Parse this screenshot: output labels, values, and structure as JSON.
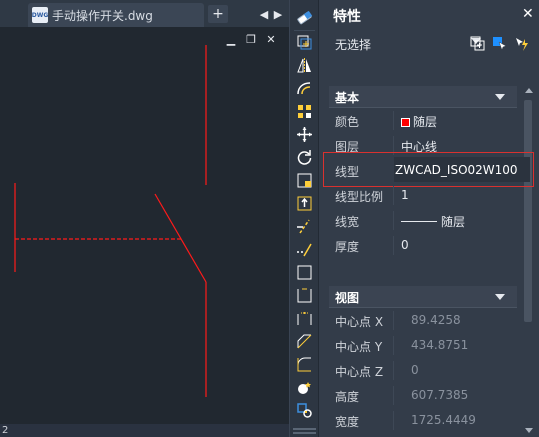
{
  "tab": {
    "doc_name": "手动操作开关.dwg",
    "file_badge": "DWG",
    "new_tab": "+"
  },
  "tab_nav": {
    "prev": "◀",
    "next": "▶"
  },
  "window_controls": {
    "minimize": "▁",
    "restore": "❐",
    "close": "✕"
  },
  "coord_readout": "2",
  "drawing": {
    "line_color": "#ff1a1a"
  },
  "toolbar": {
    "icons": [
      "eraser-icon",
      "copy-icon",
      "mirror-icon",
      "offset-icon",
      "array-icon",
      "move-icon",
      "rotate-icon",
      "scale-icon",
      "stretch-icon",
      "trim-icon",
      "extend-icon",
      "break-icon",
      "break-at-point-icon",
      "join-icon",
      "chamfer-icon",
      "fillet-icon",
      "explode-icon",
      "properties-icon"
    ]
  },
  "panel": {
    "title": "特性",
    "close": "✕",
    "selection": "无选择",
    "sections": [
      {
        "name": "基本",
        "rows": [
          {
            "key": "颜色",
            "value": "随层",
            "swatch": "#ff0000"
          },
          {
            "key": "图层",
            "value": "中心线"
          },
          {
            "key": "线型",
            "value": "ZWCAD_ISO02W100",
            "highlight": true
          },
          {
            "key": "线型比例",
            "value": "1"
          },
          {
            "key": "线宽",
            "value": "随层"
          },
          {
            "key": "厚度",
            "value": "0"
          }
        ]
      },
      {
        "name": "视图",
        "rows": [
          {
            "key": "中心点 X",
            "value": "89.4258",
            "dim": true
          },
          {
            "key": "中心点 Y",
            "value": "434.8751",
            "dim": true
          },
          {
            "key": "中心点 Z",
            "value": "0",
            "dim": true
          },
          {
            "key": "高度",
            "value": "607.7385",
            "dim": true
          },
          {
            "key": "宽度",
            "value": "1725.4449",
            "dim": true
          }
        ]
      }
    ]
  },
  "colors": {
    "highlight_border": "#d9312f",
    "accent": "#1e90ff"
  }
}
